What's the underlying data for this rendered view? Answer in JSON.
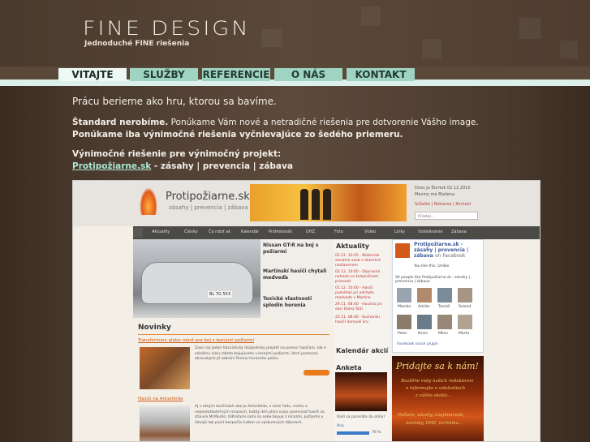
{
  "brand": {
    "logo": "FINE DESIGN",
    "tagline": "Jednoduché FINE riešenia"
  },
  "nav": {
    "tabs": [
      {
        "label": "VITAJTE",
        "active": true
      },
      {
        "label": "SLUŽBY"
      },
      {
        "label": "REFERENCIE"
      },
      {
        "label": "O NÁS"
      },
      {
        "label": "KONTAKT"
      }
    ]
  },
  "content": {
    "headline": "Prácu berieme ako hru, ktorou sa bavíme.",
    "lead_bold": "Štandard nerobíme.",
    "lead_text": " Ponúkame Vám nové a netradičné riešenia pre dotvorenie Vášho image.",
    "lead2": "Ponúkame iba výnimočné riešenia vyčnievajúce zo šedého priemeru.",
    "project_intro": "Výnimočné riešenie pre výnimočný projekt:",
    "project_link": "Protipožiarne.sk",
    "project_desc": " - zásahy | prevencia | zábava"
  },
  "preview": {
    "site_name": "Protipožiarne.sk",
    "site_sub": "zásahy | prevencia | zábava",
    "date": "Dnes je Štvrtok 02.12.2010",
    "nameday": "Meniny má Blažena",
    "top_links": "Súťažte  |  Reklama  |  Kontakt",
    "search_placeholder": "hľadaj...",
    "menu": [
      "Aktuality",
      "Články",
      "Čo robiť ak",
      "Kalendár",
      "Profesionáli",
      "DHZ",
      "Foto",
      "Video",
      "Linky",
      "Vzdelávanie",
      "Zábava"
    ],
    "feature_items": [
      "Nissan GT-R na boj s požiarmi",
      "Martinskí hasiči chytali medveďa",
      "Toxické vlastnosti splodín horenia"
    ],
    "plate": "BL 7G 553",
    "aktuality_title": "Aktuality",
    "aktuality": [
      "02.12. 10:45 - Motorista zasiahol osob v dezertné nastavenom",
      "02.12. 10:00 - Dopravná nehoda na železničnom priecestí",
      "01.12. 10:00 - Hasiči pomáhali pri odchyte medveďa v Martine",
      "29.11. 08:40 - Havária pri obci Dolný Štál",
      "25.11. 08:40 - Kuchárski hasiči darovali krv"
    ],
    "kalendar_title": "Kalendár akcií",
    "anketa_title": "Anketa",
    "anketa_question": "Radi sa pozeráte do ohňa?",
    "anketa_answer": "Áno",
    "anketa_percent": "76 %",
    "facebook": {
      "title": "Protipožiarne.sk - zásahy | prevencia | zábava",
      "on": "on Facebook",
      "like": "You like this. Unlike",
      "count": "94 people like Protipožiarne.sk - zásahy | prevencia | zábava",
      "people": [
        "Monika",
        "Adrián",
        "Tomáš",
        "Roland",
        "Peter",
        "Kevin",
        "Milan",
        "Marta"
      ],
      "plugin": "Facebook social plugin"
    },
    "ad": {
      "title": "Pridajte sa k nám!",
      "lines": [
        "Rozšírte rady našich redaktorov",
        "a informujte o udalostiach",
        "z vášho okolia...",
        "Požiare, zásahy, zaujímavosti,",
        "novinky, DHZ, technika..."
      ]
    },
    "novinky_title": "Novinky",
    "articles": [
      {
        "title": "Transformers alebo robot pre boj s lesnými požiarmi",
        "text": "Zase raz jeden futuristický dizajnérsky projekt na pomoc hasičom. Ide o odvážnu víziu robota bojujúceho s lesnými požiarmi, ktorí pomocou obrovských pĺ zabráni šíreniu horúceho pekla."
      },
      {
        "title": "Hasiči na Antarktíde",
        "text": "Aj v takých končinách ako je Antarktída, v zemi ľadu, snehu a nepreskákateľných mrazoch, každý deň plnia svoju povinnosť hasiči zo stanice McMurdo. Odhaľami sami na sebe bojujú z mrazmi, požiarmi a dávajú tak pocit bezpečia ľuďom vo výskumných táboroch."
      }
    ]
  }
}
